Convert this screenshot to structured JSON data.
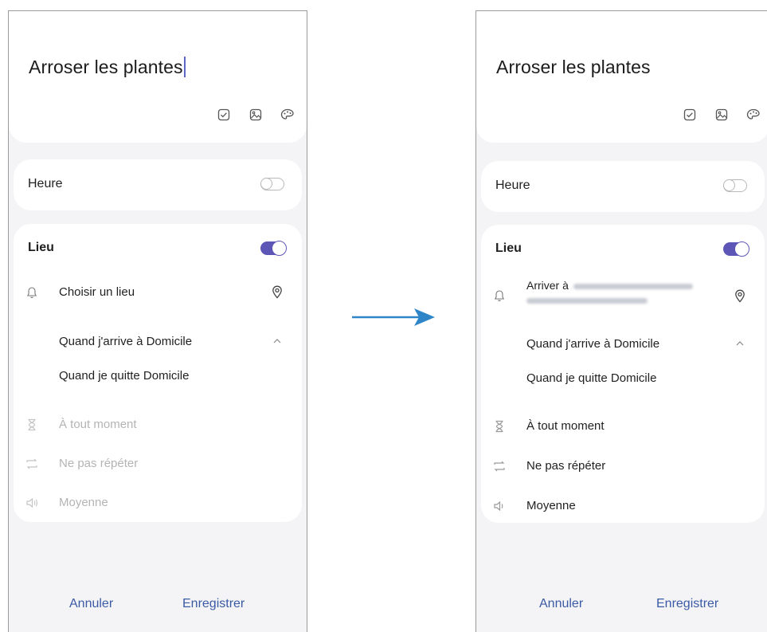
{
  "left": {
    "title": "Arroser les plantes",
    "heure_label": "Heure",
    "lieu_label": "Lieu",
    "location_row": "Choisir un lieu",
    "option_arrive": "Quand j'arrive à Domicile",
    "option_leave": "Quand je quitte Domicile",
    "time_row": "À tout moment",
    "repeat_row": "Ne pas répéter",
    "priority_row": "Moyenne",
    "cancel": "Annuler",
    "save": "Enregistrer"
  },
  "right": {
    "title": "Arroser les plantes",
    "heure_label": "Heure",
    "lieu_label": "Lieu",
    "location_row": "Arriver à",
    "option_arrive": "Quand j'arrive à Domicile",
    "option_leave": "Quand je quitte Domicile",
    "time_row": "À tout moment",
    "repeat_row": "Ne pas répéter",
    "priority_row": "Moyenne",
    "cancel": "Annuler",
    "save": "Enregistrer"
  },
  "icons": [
    "checkbox-icon",
    "image-icon",
    "palette-icon",
    "bell-icon",
    "location-pin-icon",
    "chevron-up-icon",
    "hourglass-icon",
    "repeat-icon",
    "volume-icon",
    "right-arrow-icon"
  ],
  "colors": {
    "accent": "#5d56b7",
    "button_text": "#3b5aa5",
    "arrow": "#2e86c8"
  }
}
